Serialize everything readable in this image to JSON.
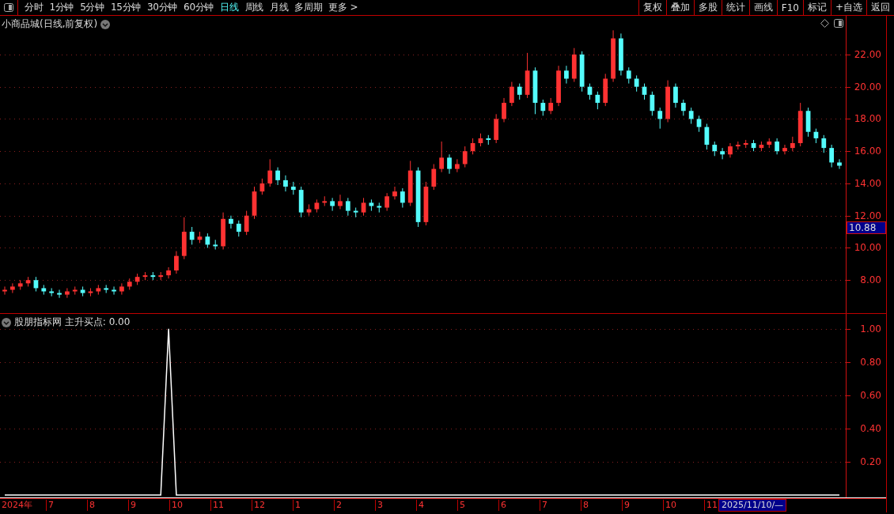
{
  "toolbar": {
    "periods": [
      {
        "label": "分时",
        "selected": false
      },
      {
        "label": "1分钟",
        "selected": false
      },
      {
        "label": "5分钟",
        "selected": false
      },
      {
        "label": "15分钟",
        "selected": false
      },
      {
        "label": "30分钟",
        "selected": false
      },
      {
        "label": "60分钟",
        "selected": false
      },
      {
        "label": "日线",
        "selected": true
      },
      {
        "label": "周线",
        "selected": false
      },
      {
        "label": "月线",
        "selected": false
      },
      {
        "label": "多周期",
        "selected": false
      },
      {
        "label": "更多 >",
        "selected": false
      }
    ],
    "buttons": [
      "复权",
      "叠加",
      "多股",
      "统计",
      "画线",
      "F10",
      "标记",
      "+自选",
      "返回"
    ]
  },
  "price_pane": {
    "title": "小商品城(日线,前复权)",
    "current_price": "10.88",
    "chart_data": {
      "type": "candlestick",
      "yticks": [
        {
          "value": 8,
          "label": "8.00"
        },
        {
          "value": 10,
          "label": "10.00"
        },
        {
          "value": 12,
          "label": "12.00"
        },
        {
          "value": 14,
          "label": "14.00"
        },
        {
          "value": 16,
          "label": "16.00"
        },
        {
          "value": 18,
          "label": "18.00"
        },
        {
          "value": 20,
          "label": "20.00"
        },
        {
          "value": 22,
          "label": "22.00"
        }
      ],
      "ylim": [
        6.0,
        24.4
      ],
      "grid": true,
      "categories": [
        null,
        null,
        null,
        null,
        null,
        null,
        null,
        null,
        null,
        null,
        null,
        null,
        null,
        null,
        null,
        null,
        null,
        null,
        null,
        null,
        null,
        null,
        null,
        null,
        null,
        null,
        null,
        null,
        null,
        null,
        null,
        null,
        null,
        null,
        null,
        null,
        null,
        null,
        null,
        null,
        null,
        null,
        null,
        null,
        null,
        null,
        null,
        null,
        null,
        null,
        null,
        null,
        null,
        null,
        null,
        null,
        null,
        null,
        null,
        null,
        null,
        null,
        null,
        null,
        null,
        null,
        null,
        null,
        null,
        null,
        null,
        null,
        null,
        null,
        null,
        null,
        null,
        null,
        null,
        null,
        null,
        null,
        null,
        null,
        null,
        null,
        null,
        null,
        null,
        null,
        null,
        null,
        null,
        null,
        null,
        null,
        null,
        null,
        null,
        null,
        null,
        null,
        null,
        null,
        null,
        null,
        null,
        null
      ],
      "ohlc": [
        [
          7.3,
          7.6,
          7.1,
          7.4
        ],
        [
          7.4,
          7.8,
          7.2,
          7.6
        ],
        [
          7.6,
          8.0,
          7.4,
          7.8
        ],
        [
          7.8,
          8.2,
          7.6,
          8.0
        ],
        [
          8.0,
          8.2,
          7.3,
          7.5
        ],
        [
          7.5,
          7.7,
          7.1,
          7.3
        ],
        [
          7.3,
          7.5,
          7.0,
          7.2
        ],
        [
          7.2,
          7.4,
          6.9,
          7.1
        ],
        [
          7.1,
          7.5,
          6.9,
          7.3
        ],
        [
          7.3,
          7.6,
          7.1,
          7.4
        ],
        [
          7.4,
          7.6,
          7.0,
          7.2
        ],
        [
          7.2,
          7.5,
          7.0,
          7.3
        ],
        [
          7.3,
          7.7,
          7.1,
          7.5
        ],
        [
          7.5,
          7.7,
          7.2,
          7.4
        ],
        [
          7.4,
          7.6,
          7.1,
          7.3
        ],
        [
          7.3,
          7.8,
          7.1,
          7.6
        ],
        [
          7.6,
          8.1,
          7.4,
          7.9
        ],
        [
          7.9,
          8.4,
          7.7,
          8.2
        ],
        [
          8.2,
          8.5,
          8.0,
          8.3
        ],
        [
          8.3,
          8.5,
          8.0,
          8.2
        ],
        [
          8.2,
          8.5,
          8.0,
          8.3
        ],
        [
          8.3,
          8.8,
          8.1,
          8.6
        ],
        [
          8.6,
          9.8,
          8.4,
          9.5
        ],
        [
          9.5,
          11.9,
          9.3,
          11.0
        ],
        [
          11.0,
          11.3,
          10.2,
          10.5
        ],
        [
          10.5,
          11.0,
          10.3,
          10.7
        ],
        [
          10.7,
          10.9,
          10.0,
          10.2
        ],
        [
          10.2,
          10.5,
          9.9,
          10.1
        ],
        [
          10.1,
          12.2,
          9.9,
          11.8
        ],
        [
          11.8,
          12.0,
          11.2,
          11.5
        ],
        [
          11.5,
          11.7,
          10.7,
          11.0
        ],
        [
          11.0,
          12.3,
          10.8,
          12.0
        ],
        [
          12.0,
          13.8,
          11.8,
          13.5
        ],
        [
          13.5,
          14.3,
          13.3,
          14.0
        ],
        [
          14.0,
          15.5,
          13.8,
          14.8
        ],
        [
          14.8,
          15.0,
          13.9,
          14.2
        ],
        [
          14.2,
          14.5,
          13.5,
          13.8
        ],
        [
          13.8,
          14.1,
          13.3,
          13.6
        ],
        [
          13.6,
          13.8,
          11.9,
          12.2
        ],
        [
          12.2,
          12.7,
          12.0,
          12.4
        ],
        [
          12.4,
          13.0,
          12.2,
          12.8
        ],
        [
          12.8,
          13.2,
          12.6,
          12.9
        ],
        [
          12.9,
          13.1,
          12.3,
          12.6
        ],
        [
          12.6,
          13.3,
          12.4,
          12.9
        ],
        [
          12.9,
          13.1,
          12.0,
          12.3
        ],
        [
          12.3,
          12.5,
          11.9,
          12.2
        ],
        [
          12.2,
          13.1,
          12.0,
          12.8
        ],
        [
          12.8,
          13.0,
          12.3,
          12.6
        ],
        [
          12.6,
          12.8,
          12.2,
          12.5
        ],
        [
          12.5,
          13.4,
          12.3,
          13.2
        ],
        [
          13.2,
          13.8,
          13.0,
          13.5
        ],
        [
          13.5,
          13.7,
          12.5,
          12.8
        ],
        [
          12.8,
          15.4,
          12.6,
          14.8
        ],
        [
          14.8,
          15.0,
          11.3,
          11.6
        ],
        [
          11.6,
          14.1,
          11.4,
          13.8
        ],
        [
          13.8,
          15.2,
          13.6,
          14.9
        ],
        [
          14.9,
          16.6,
          14.7,
          15.6
        ],
        [
          15.6,
          15.8,
          14.6,
          14.9
        ],
        [
          14.9,
          15.5,
          14.7,
          15.2
        ],
        [
          15.2,
          16.3,
          15.0,
          16.0
        ],
        [
          16.0,
          16.8,
          15.8,
          16.5
        ],
        [
          16.5,
          17.1,
          16.3,
          16.8
        ],
        [
          16.8,
          17.0,
          16.4,
          16.7
        ],
        [
          16.7,
          18.3,
          16.5,
          18.0
        ],
        [
          18.0,
          19.3,
          17.8,
          19.0
        ],
        [
          19.0,
          20.3,
          18.8,
          20.0
        ],
        [
          20.0,
          20.2,
          19.2,
          19.5
        ],
        [
          19.5,
          22.1,
          19.3,
          21.0
        ],
        [
          21.0,
          21.2,
          18.3,
          19.0
        ],
        [
          19.0,
          19.2,
          18.2,
          18.5
        ],
        [
          18.5,
          19.3,
          18.3,
          19.0
        ],
        [
          19.0,
          21.3,
          18.8,
          21.0
        ],
        [
          21.0,
          21.3,
          20.2,
          20.5
        ],
        [
          20.5,
          22.4,
          20.3,
          22.0
        ],
        [
          22.0,
          22.2,
          19.7,
          20.0
        ],
        [
          20.0,
          20.2,
          19.2,
          19.5
        ],
        [
          19.5,
          19.7,
          18.6,
          19.0
        ],
        [
          19.0,
          20.8,
          18.8,
          20.5
        ],
        [
          20.5,
          23.5,
          20.3,
          23.0
        ],
        [
          23.0,
          23.3,
          20.7,
          21.0
        ],
        [
          21.0,
          21.2,
          20.2,
          20.5
        ],
        [
          20.5,
          20.7,
          19.7,
          20.0
        ],
        [
          20.0,
          20.2,
          19.2,
          19.5
        ],
        [
          19.5,
          19.7,
          18.2,
          18.5
        ],
        [
          18.5,
          18.7,
          17.4,
          18.0
        ],
        [
          18.0,
          20.4,
          17.8,
          20.0
        ],
        [
          20.0,
          20.2,
          18.7,
          19.0
        ],
        [
          19.0,
          19.2,
          18.2,
          18.5
        ],
        [
          18.5,
          18.7,
          17.7,
          18.0
        ],
        [
          18.0,
          18.2,
          17.2,
          17.5
        ],
        [
          17.5,
          17.7,
          16.1,
          16.4
        ],
        [
          16.4,
          16.6,
          15.7,
          16.0
        ],
        [
          16.0,
          16.2,
          15.5,
          15.8
        ],
        [
          15.8,
          16.5,
          15.6,
          16.3
        ],
        [
          16.3,
          16.6,
          16.1,
          16.4
        ],
        [
          16.4,
          16.7,
          16.2,
          16.5
        ],
        [
          16.5,
          16.7,
          16.0,
          16.2
        ],
        [
          16.2,
          16.6,
          16.0,
          16.4
        ],
        [
          16.4,
          16.8,
          16.2,
          16.6
        ],
        [
          16.6,
          16.8,
          15.8,
          16.0
        ],
        [
          16.0,
          16.4,
          15.8,
          16.2
        ],
        [
          16.2,
          16.9,
          16.0,
          16.5
        ],
        [
          16.5,
          19.0,
          16.3,
          18.5
        ],
        [
          18.5,
          18.7,
          16.9,
          17.2
        ],
        [
          17.2,
          17.4,
          16.5,
          16.8
        ],
        [
          16.8,
          17.0,
          15.9,
          16.2
        ],
        [
          16.2,
          16.4,
          15.0,
          15.3
        ],
        [
          15.3,
          15.5,
          14.9,
          15.1
        ]
      ]
    }
  },
  "indicator_pane": {
    "title": "股朋指标网 主升买点: 0.00",
    "chart_data": {
      "type": "line",
      "ylim": [
        -0.015,
        1.09
      ],
      "grid": true,
      "yticks": [
        {
          "value": 0.2,
          "label": "0.20"
        },
        {
          "value": 0.4,
          "label": "0.40"
        },
        {
          "value": 0.6,
          "label": "0.60"
        },
        {
          "value": 0.8,
          "label": "0.80"
        },
        {
          "value": 1,
          "label": "1.00"
        }
      ],
      "categories": [
        null,
        null,
        null,
        null,
        null,
        null,
        null,
        null,
        null,
        null,
        null,
        null,
        null,
        null,
        null,
        null,
        null,
        null,
        null,
        null,
        null,
        null,
        null,
        null,
        null,
        null,
        null,
        null,
        null,
        null,
        null,
        null,
        null,
        null,
        null,
        null,
        null,
        null,
        null,
        null,
        null,
        null,
        null,
        null,
        null,
        null,
        null,
        null,
        null,
        null,
        null,
        null,
        null,
        null,
        null,
        null,
        null,
        null,
        null,
        null,
        null,
        null,
        null,
        null,
        null,
        null,
        null,
        null,
        null,
        null,
        null,
        null,
        null,
        null,
        null,
        null,
        null,
        null,
        null,
        null,
        null,
        null,
        null,
        null,
        null,
        null,
        null,
        null,
        null,
        null,
        null,
        null,
        null,
        null,
        null,
        null,
        null,
        null,
        null,
        null,
        null,
        null,
        null,
        null,
        null,
        null,
        null,
        null
      ],
      "series": [
        {
          "color": "#ffffff",
          "values": [
            0,
            0,
            0,
            0,
            0,
            0,
            0,
            0,
            0,
            0,
            0,
            0,
            0,
            0,
            0,
            0,
            0,
            0,
            0,
            0,
            0,
            1,
            0,
            0,
            0,
            0,
            0,
            0,
            0,
            0,
            0,
            0,
            0,
            0,
            0,
            0,
            0,
            0,
            0,
            0,
            0,
            0,
            0,
            0,
            0,
            0,
            0,
            0,
            0,
            0,
            0,
            0,
            0,
            0,
            0,
            0,
            0,
            0,
            0,
            0,
            0,
            0,
            0,
            0,
            0,
            0,
            0,
            0,
            0,
            0,
            0,
            0,
            0,
            0,
            0,
            0,
            0,
            0,
            0,
            0,
            0,
            0,
            0,
            0,
            0,
            0,
            0,
            0,
            0,
            0,
            0,
            0,
            0,
            0,
            0,
            0,
            0,
            0,
            0,
            0,
            0,
            0,
            0,
            0,
            0,
            0,
            0,
            0
          ]
        }
      ]
    }
  },
  "date_axis": {
    "labels": [
      "2024年",
      "7",
      "8",
      "9",
      "10",
      "11",
      "12",
      "1",
      "2",
      "3",
      "4",
      "5",
      "6",
      "7",
      "8",
      "9",
      "10",
      "11"
    ],
    "cursor_date": "2025/11/10/—"
  }
}
